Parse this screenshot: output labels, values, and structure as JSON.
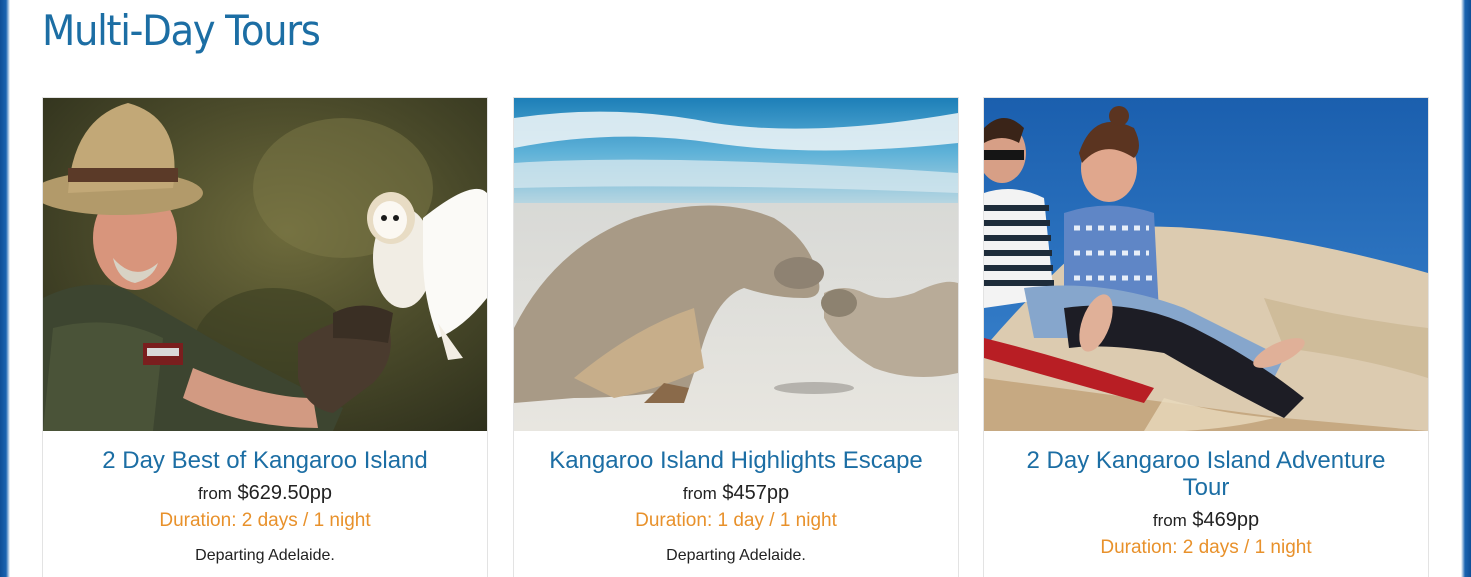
{
  "page": {
    "title": "Multi-Day Tours"
  },
  "tours": [
    {
      "title": "2 Day Best of Kangaroo Island",
      "price_prefix": "from",
      "price": "$629.50pp",
      "duration": "Duration: 2 days / 1 night",
      "departing": "Departing Adelaide.",
      "image": "guide-holding-barn-owl-photo"
    },
    {
      "title": "Kangaroo Island Highlights Escape",
      "price_prefix": "from",
      "price": "$457pp",
      "duration": "Duration: 1 day / 1 night",
      "departing": "Departing Adelaide.",
      "image": "sea-lions-on-beach-photo"
    },
    {
      "title": "2 Day Kangaroo Island Adventure Tour",
      "price_prefix": "from",
      "price": "$469pp",
      "duration": "Duration: 2 days / 1 night",
      "image": "sandboarding-dunes-photo"
    }
  ],
  "colors": {
    "title_blue": "#1c6ea4",
    "duration_orange": "#e8912b",
    "frame_blue": "#0e4e97"
  }
}
